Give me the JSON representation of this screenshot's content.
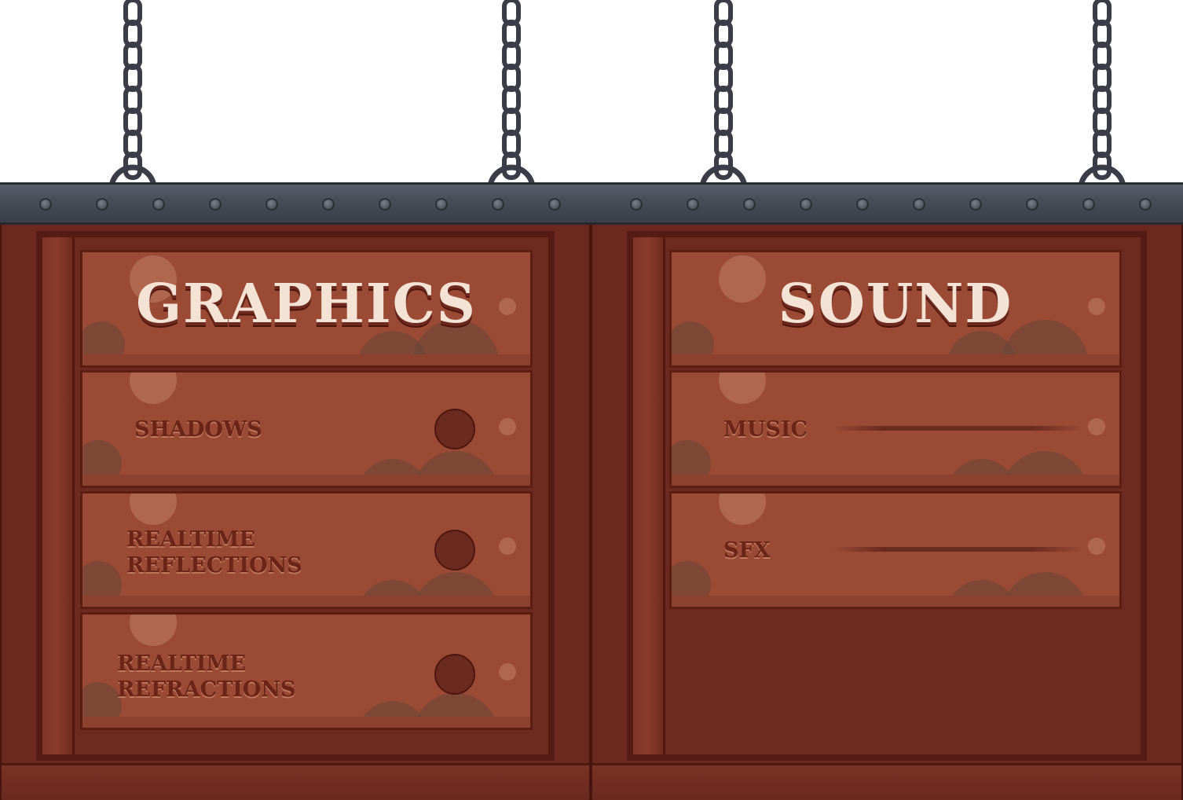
{
  "graphics_panel": {
    "title": "GRAPHICS",
    "settings": [
      {
        "label": "SHADOWS"
      },
      {
        "label": "REALTIME\nREFLECTIONS"
      },
      {
        "label": "REALTIME\nREFRACTIONS"
      }
    ]
  },
  "sound_panel": {
    "title": "SOUND",
    "settings": [
      {
        "label": "MUSIC"
      },
      {
        "label": "SFX"
      }
    ]
  },
  "colors": {
    "wood": "#9a4a35",
    "frame": "#6a281e",
    "metal": "#494d58",
    "title_text": "#f4e3d4",
    "label_text": "#6a2418"
  },
  "icons": [
    "chain-icon",
    "rivet-icon",
    "toggle-knob-icon"
  ]
}
